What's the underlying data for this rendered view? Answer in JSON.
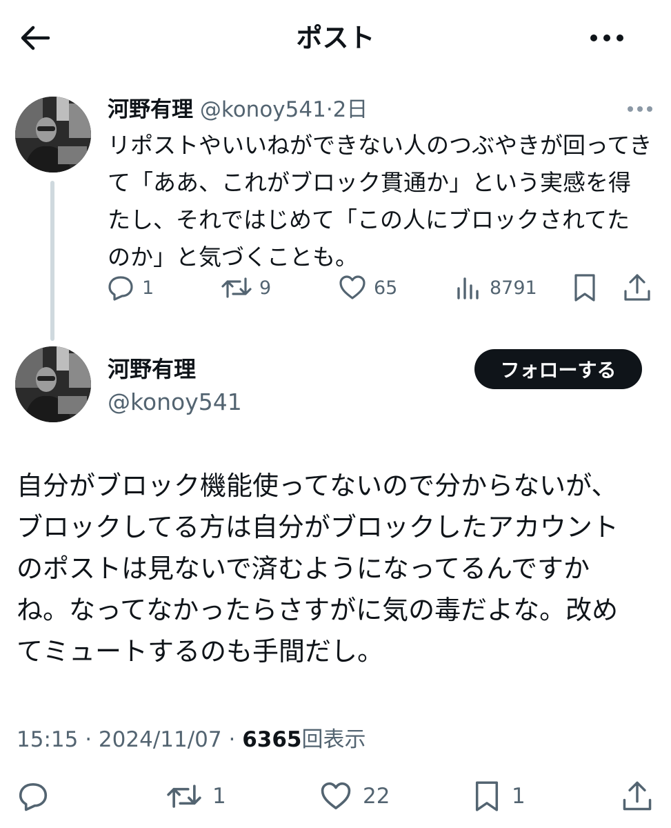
{
  "header": {
    "title": "ポスト"
  },
  "parent_post": {
    "author_name": "河野有理",
    "handle": "@konoy541",
    "separator": "·",
    "time_ago": "2日",
    "text": "リポストやいいねができない人のつぶやきが回ってきて「ああ、これがブロック貫通か」という実感を得たし、それではじめて「この人にブロックされてたのか」と気づくことも。",
    "metrics": {
      "replies": "1",
      "reposts": "9",
      "likes": "65",
      "views": "8791"
    }
  },
  "main_post": {
    "author_name": "河野有理",
    "handle": "@konoy541",
    "follow_label": "フォローする",
    "text": "自分がブロック機能使ってないので分からないが、ブロックしてる方は自分がブロックしたアカウントのポストは見ないで済むようになってるんですかね。なってなかったらさすがに気の毒だよな。改めてミュートするのも手間だし。",
    "time": "15:15",
    "date": "2024/11/07",
    "sep": "·",
    "view_count": "6365",
    "view_label": "回表示",
    "metrics": {
      "reposts": "1",
      "likes": "22",
      "bookmarks": "1"
    }
  },
  "icons": [
    "back-arrow-icon",
    "more-icon",
    "caret-more-icon",
    "reply-icon",
    "repost-icon",
    "like-icon",
    "views-icon",
    "bookmark-icon",
    "share-icon"
  ]
}
